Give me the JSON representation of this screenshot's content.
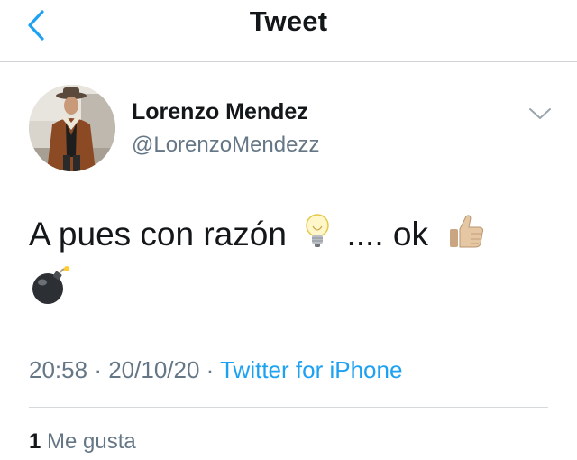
{
  "header": {
    "title": "Tweet",
    "back_icon": "chevron-left-icon",
    "accent": "#1da1f2"
  },
  "author": {
    "name": "Lorenzo Mendez",
    "handle": "@LorenzoMendezz"
  },
  "tweet": {
    "text_part1": "A pues con razón",
    "text_part2": ".... ok",
    "emojis": [
      "light-bulb-icon",
      "thumbs-up-icon",
      "bomb-icon"
    ]
  },
  "meta": {
    "time": "20:58",
    "separator": "·",
    "date": "20/10/20",
    "source": "Twitter for iPhone"
  },
  "likes": {
    "count": "1",
    "label": "Me gusta"
  },
  "colors": {
    "text": "#14171a",
    "secondary": "#657786",
    "link": "#1da1f2"
  }
}
